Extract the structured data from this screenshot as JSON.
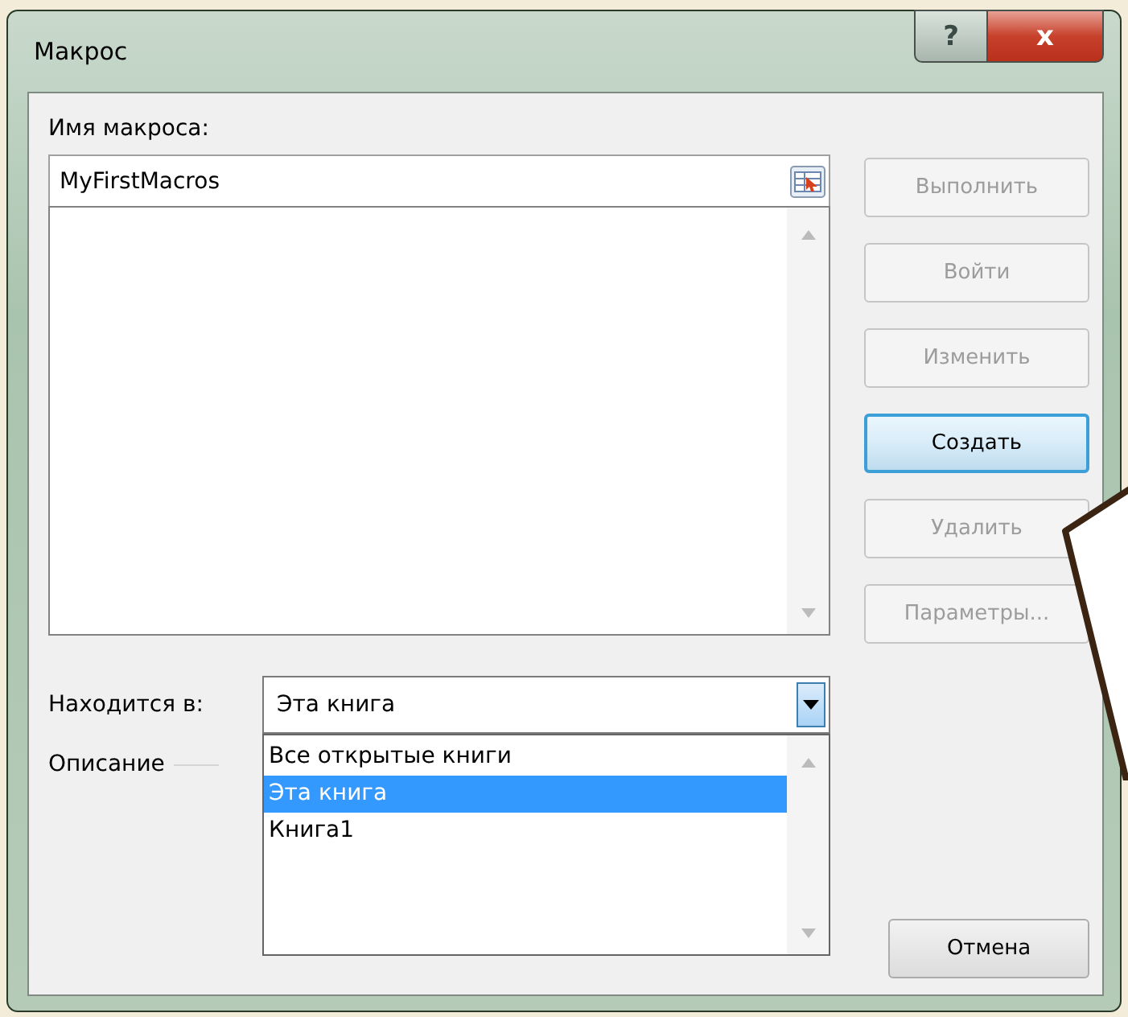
{
  "window": {
    "title": "Макрос",
    "help": "?",
    "close": "x"
  },
  "macro_name": {
    "label": "Имя макроса:",
    "value": "MyFirstMacros"
  },
  "buttons": [
    {
      "label": "Выполнить",
      "disabled": true,
      "default": false
    },
    {
      "label": "Войти",
      "disabled": true,
      "default": false
    },
    {
      "label": "Изменить",
      "disabled": true,
      "default": false
    },
    {
      "label": "Создать",
      "disabled": false,
      "default": true
    },
    {
      "label": "Удалить",
      "disabled": true,
      "default": false
    },
    {
      "label": "Параметры...",
      "disabled": true,
      "default": false
    }
  ],
  "location": {
    "label": "Находится в:",
    "value": "Эта книга",
    "expanded": true,
    "options": [
      {
        "label": "Все открытые книги",
        "selected": false
      },
      {
        "label": "Эта книга",
        "selected": true
      },
      {
        "label": "Книга1",
        "selected": false
      }
    ]
  },
  "description": {
    "label": "Описание"
  },
  "cancel": {
    "label": "Отмена"
  }
}
